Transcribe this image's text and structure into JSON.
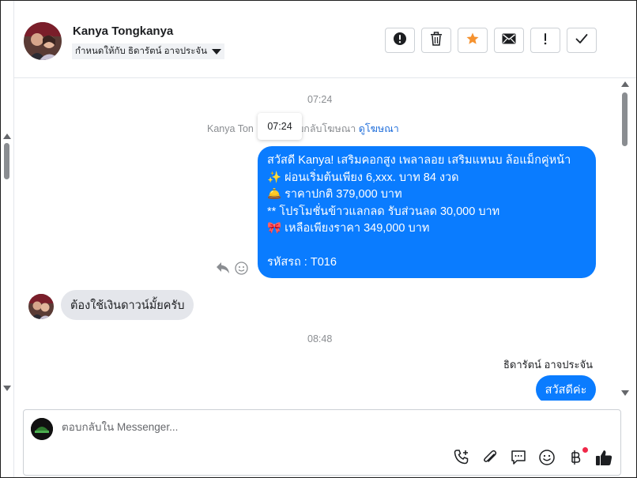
{
  "header": {
    "contact_name": "Kanya Tongkanya",
    "assign_label": "กำหนดให้กับ ธิดารัตน์ อาจประจัน",
    "toolbar": [
      {
        "name": "mark-spam-button",
        "icon": "alert-circle-icon"
      },
      {
        "name": "delete-button",
        "icon": "trash-icon"
      },
      {
        "name": "star-button",
        "icon": "star-icon"
      },
      {
        "name": "mark-unread-button",
        "icon": "envelope-icon"
      },
      {
        "name": "follow-up-button",
        "icon": "exclamation-icon"
      },
      {
        "name": "mark-done-button",
        "icon": "checkmark-icon"
      }
    ]
  },
  "thread": {
    "timestamp_1": "07:24",
    "ad_note_sender": "Kanya Ton",
    "ad_note_text": "อบกลับโฆษณา",
    "ad_link": "ดูโฆษณา",
    "tooltip": "07:24",
    "outgoing_ad_message": {
      "lines": [
        "สวัสดี Kanya! เสริมคอกสูง เพลาลอย เสริมแหนบ ล้อแม็กคู่หน้า",
        "✨  ผ่อนเริ่มต้นเพียง 6,xxx. บาท 84 งวด",
        "🛎️ ราคาปกติ 379,000 บาท",
        "** โปรโมชั่นข้าวแลกลด รับส่วนลด 30,000 บาท",
        "🎀  เหลือเพียงราคา 349,000 บาท",
        "รหัสรถ : T016"
      ]
    },
    "incoming_message": "ต้องใช้เงินดาวน์มั้ยครับ",
    "timestamp_2": "08:48",
    "agent_name": "ธิดารัตน์ อาจประจัน",
    "outgoing_greeting": "สวัสดีค่ะ"
  },
  "composer": {
    "placeholder": "ตอบกลับใน Messenger...",
    "icons": [
      "phone-plus-icon",
      "paperclip-icon",
      "chat-bubble-icon",
      "smiley-icon",
      "baht-icon",
      "thumbs-up-icon"
    ]
  },
  "colors": {
    "accent_blue": "#0a7cff",
    "incoming_bubble": "#e4e6eb",
    "star_orange": "#f5922f",
    "notification_red": "#f02849"
  }
}
